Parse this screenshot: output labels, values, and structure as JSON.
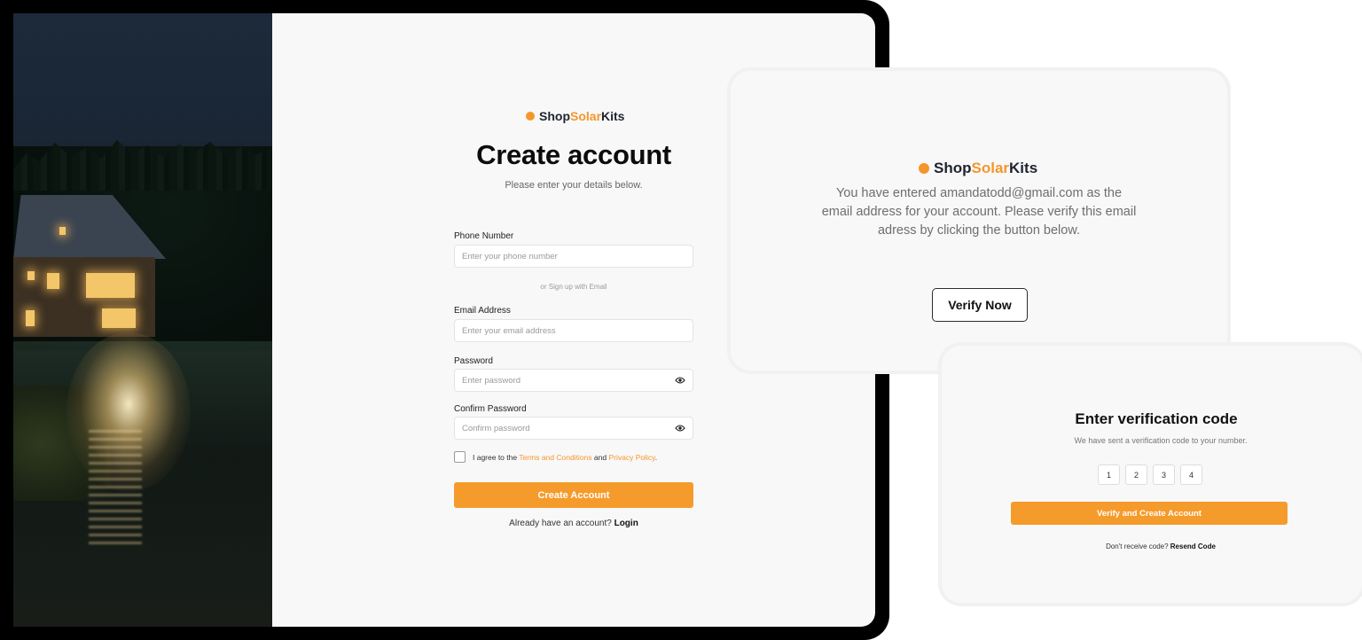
{
  "brand": {
    "part1": "Shop",
    "part2": "Solar",
    "part3": "Kits",
    "accent_color": "#f5962a"
  },
  "signup": {
    "title": "Create account",
    "subtitle": "Please enter your details below.",
    "phone_label": "Phone Number",
    "phone_placeholder": "Enter your phone number",
    "or_text": "or Sign up with Email",
    "email_label": "Email Address",
    "email_placeholder": "Enter your email address",
    "password_label": "Password",
    "password_placeholder": "Enter password",
    "confirm_label": "Confirm Password",
    "confirm_placeholder": "Confirm password",
    "agree_prefix": "I agree to the",
    "terms_link": "Terms and Conditions",
    "agree_and": "and",
    "privacy_link": "Privacy Policy",
    "agree_suffix": ".",
    "submit_label": "Create Account",
    "already_text": "Already have an account?",
    "login_link": "Login"
  },
  "email_verify": {
    "message": "You have entered amandatodd@gmail.com as the email address for your account. Please verify this email adress by clicking the button below.",
    "button_label": "Verify Now"
  },
  "code_verify": {
    "title": "Enter verification code",
    "subtitle": "We have sent a verification code to your number.",
    "digits": [
      "1",
      "2",
      "3",
      "4"
    ],
    "button_label": "Verify and Create Account",
    "resend_prefix": "Don't receive code?",
    "resend_link": "Resend Code"
  }
}
